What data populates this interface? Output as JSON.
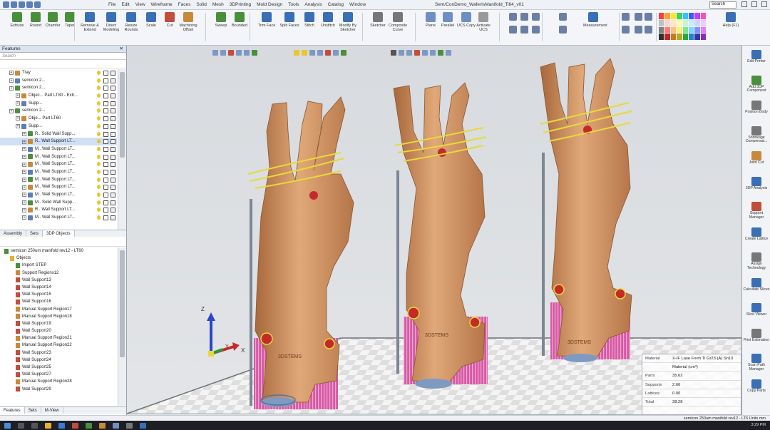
{
  "menu": {
    "items": [
      "File",
      "Edit",
      "View",
      "Wireframe",
      "Faces",
      "Solid",
      "Mesh",
      "3DPrinting",
      "Mold Design",
      "Tools",
      "Analysis",
      "Catalog",
      "Window"
    ],
    "window_title": "Sem/ConDemo_WaferIsManifold_Ti64_v01",
    "search_placeholder": "Search"
  },
  "ribbon": {
    "buttons": [
      {
        "label": "Extrude",
        "color": "#4a8f3c"
      },
      {
        "label": "Round",
        "color": "#4a8f3c"
      },
      {
        "label": "Chamfer",
        "color": "#4a8f3c"
      },
      {
        "label": "Taper",
        "color": "#4a8f3c"
      },
      {
        "label": "Remove & Extend",
        "color": "#3a6fb5"
      },
      {
        "label": "Direct Modeling",
        "color": "#3a6fb5"
      },
      {
        "label": "Resize Rounds",
        "color": "#3a6fb5"
      },
      {
        "label": "Scale",
        "color": "#3a6fb5"
      },
      {
        "label": "Cut",
        "color": "#c14d3a"
      },
      {
        "label": "Machining Offset",
        "color": "#c9893a"
      },
      {
        "label": "Sweep",
        "color": "#4a8f3c"
      },
      {
        "label": "Bounded",
        "color": "#4a8f3c"
      },
      {
        "label": "Trim Face",
        "color": "#3a6fb5"
      },
      {
        "label": "Split Faces",
        "color": "#3a6fb5"
      },
      {
        "label": "Stitch",
        "color": "#3a6fb5"
      },
      {
        "label": "Unstitch",
        "color": "#3a6fb5"
      },
      {
        "label": "Modify By Sketcher",
        "color": "#3a6fb5"
      },
      {
        "label": "Sketcher",
        "color": "#777777"
      },
      {
        "label": "Composite Curve",
        "color": "#777777"
      },
      {
        "label": "Plane",
        "color": "#6f8fc2"
      },
      {
        "label": "Parallel",
        "color": "#6f8fc2"
      },
      {
        "label": "UCS Copy",
        "color": "#6f8fc2"
      },
      {
        "label": "Activate UCS",
        "color": "#999999"
      },
      {
        "label": "Measurement",
        "color": "#3a6fb5"
      },
      {
        "label": "Help (F1)",
        "color": "#3a6fb5"
      }
    ]
  },
  "features": {
    "title": "Features",
    "search_placeholder": "Search",
    "rows": [
      {
        "indent": 1,
        "text": "Tray"
      },
      {
        "indent": 1,
        "text": "semicon 2..."
      },
      {
        "indent": 1,
        "text": "semicon 2..."
      },
      {
        "indent": 2,
        "text": "Objec...    Part LT80 - Extr..."
      },
      {
        "indent": 2,
        "text": "Supp..."
      },
      {
        "indent": 1,
        "text": "semicon 2..."
      },
      {
        "indent": 2,
        "text": "Obje...    Part LT60"
      },
      {
        "indent": 2,
        "text": "Supp..."
      },
      {
        "indent": 3,
        "text": "R..  Solid Wall Supp..."
      },
      {
        "indent": 3,
        "text": "R..  Wall Support LT..."
      },
      {
        "indent": 3,
        "text": "M..  Wall Support LT..."
      },
      {
        "indent": 3,
        "text": "M..  Wall Support LT..."
      },
      {
        "indent": 3,
        "text": "M..  Wall Support LT..."
      },
      {
        "indent": 3,
        "text": "M..  Wall Support LT..."
      },
      {
        "indent": 3,
        "text": "M..  Wall Support LT..."
      },
      {
        "indent": 3,
        "text": "M..  Wall Support LT..."
      },
      {
        "indent": 3,
        "text": "M..  Wall Support LT..."
      },
      {
        "indent": 3,
        "text": "M..  Solid Wall Supp..."
      },
      {
        "indent": 3,
        "text": "R..  Wall Support LT..."
      },
      {
        "indent": 3,
        "text": "M..  Wall Support LT..."
      }
    ],
    "tabs": [
      "Assembly",
      "Sets",
      "3DP Objects"
    ]
  },
  "objects": {
    "root": "semicon 250um manifold rev12 - LT60",
    "rows": [
      {
        "indent": 1,
        "text": "Objects",
        "kind": "folder"
      },
      {
        "indent": 2,
        "text": "Import STEP",
        "kind": "step"
      },
      {
        "indent": 2,
        "text": "Support Regions12",
        "kind": "manual"
      },
      {
        "indent": 2,
        "text": "Wall Support13",
        "kind": "wall"
      },
      {
        "indent": 2,
        "text": "Wall Support14",
        "kind": "wall"
      },
      {
        "indent": 2,
        "text": "Wall Support15",
        "kind": "wall"
      },
      {
        "indent": 2,
        "text": "Wall Support16",
        "kind": "wall"
      },
      {
        "indent": 2,
        "text": "Manual Support Region17",
        "kind": "manual"
      },
      {
        "indent": 2,
        "text": "Manual Support Region18",
        "kind": "manual"
      },
      {
        "indent": 2,
        "text": "Wall Support19",
        "kind": "wall"
      },
      {
        "indent": 2,
        "text": "Wall Support20",
        "kind": "wall"
      },
      {
        "indent": 2,
        "text": "Manual Support Region21",
        "kind": "manual"
      },
      {
        "indent": 2,
        "text": "Manual Support Region22",
        "kind": "manual"
      },
      {
        "indent": 2,
        "text": "Wall Support23",
        "kind": "wall"
      },
      {
        "indent": 2,
        "text": "Wall Support24",
        "kind": "wall"
      },
      {
        "indent": 2,
        "text": "Wall Support25",
        "kind": "wall"
      },
      {
        "indent": 2,
        "text": "Wall Support27",
        "kind": "wall"
      },
      {
        "indent": 2,
        "text": "Manual Support Region28",
        "kind": "manual"
      },
      {
        "indent": 2,
        "text": "Wall Support29",
        "kind": "wall"
      }
    ],
    "tabs": [
      "Features",
      "Sets",
      "M-View"
    ]
  },
  "right_toolbar": {
    "items": [
      {
        "label": "Edit Printer",
        "color": "#3a6fb5"
      },
      {
        "label": "Add 3DP Component",
        "color": "#4a8f3c"
      },
      {
        "label": "Position Body",
        "color": "#777777"
      },
      {
        "label": "Shrinkage Compensat...",
        "color": "#777777"
      },
      {
        "label": "Joint Cut",
        "color": "#c9893a"
      },
      {
        "label": "3DP Analysis",
        "color": "#3a6fb5"
      },
      {
        "label": "Support Manager",
        "color": "#c14d3a"
      },
      {
        "label": "Create Lattice",
        "color": "#3a6fb5"
      },
      {
        "label": "Assign Technology",
        "color": "#777777"
      },
      {
        "label": "Calculate Slices",
        "color": "#3a6fb5"
      },
      {
        "label": "Slice Viewer",
        "color": "#3a6fb5"
      },
      {
        "label": "Print Estimation",
        "color": "#777777"
      },
      {
        "label": "Scan Path Manager",
        "color": "#3a6fb5"
      },
      {
        "label": "Copy Parts",
        "color": "#3a6fb5"
      }
    ]
  },
  "viewport": {
    "axis_labels": {
      "z": "Z",
      "x": "X",
      "y": "Y"
    },
    "brand_text": "3DSTEMS",
    "info": [
      {
        "key": "Material",
        "value": "X-IF Lase Form Ti Gr23 (A) Sn10"
      },
      {
        "key": "",
        "value": "Material (cm³)"
      },
      {
        "key": "Parts",
        "value": "35.62"
      },
      {
        "key": "Supports",
        "value": "2.66"
      },
      {
        "key": "Lattices",
        "value": "0.00"
      },
      {
        "key": "Total",
        "value": "38.28"
      }
    ]
  },
  "status": {
    "text": "semicon 250um manifold rev12 - LT6  Units mm"
  },
  "taskbar": {
    "time": "3:29 PM"
  },
  "colors": {
    "part": "#c98f5f",
    "support": "#d957a8",
    "highlight": "#e8d93a",
    "accent_red": "#c42a2a"
  }
}
